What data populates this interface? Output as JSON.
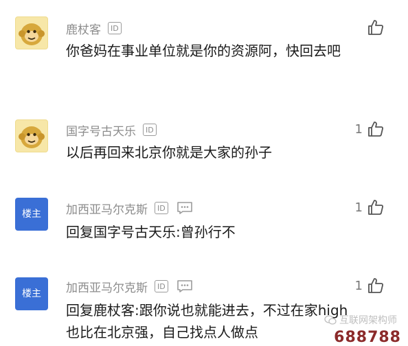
{
  "comments": [
    {
      "user": "鹿杖客",
      "id_badge": "ID",
      "avatar_type": "monkey",
      "like_count": "",
      "text": "你爸妈在事业单位就是你的资源阿，快回去吧"
    },
    {
      "user": "国字号古天乐",
      "id_badge": "ID",
      "avatar_type": "monkey",
      "like_count": "1",
      "text": "以后再回来北京你就是大家的孙子"
    },
    {
      "user": "加西亚马尔克斯",
      "id_badge": "ID",
      "avatar_type": "楼主",
      "like_count": "1",
      "text": "回复国字号古天乐:曾孙行不"
    },
    {
      "user": "加西亚马尔克斯",
      "id_badge": "ID",
      "avatar_type": "楼主",
      "like_count": "1",
      "text": "回复鹿杖客:跟你说也就能进去，不过在家high也比在北京强，自己找点人做点"
    }
  ],
  "watermark": {
    "text": "互联网架构师",
    "number": "688788"
  },
  "icons": {
    "like": "thumbs-up-icon",
    "message": "message-dots-icon",
    "monkey": "monkey-avatar-icon"
  }
}
